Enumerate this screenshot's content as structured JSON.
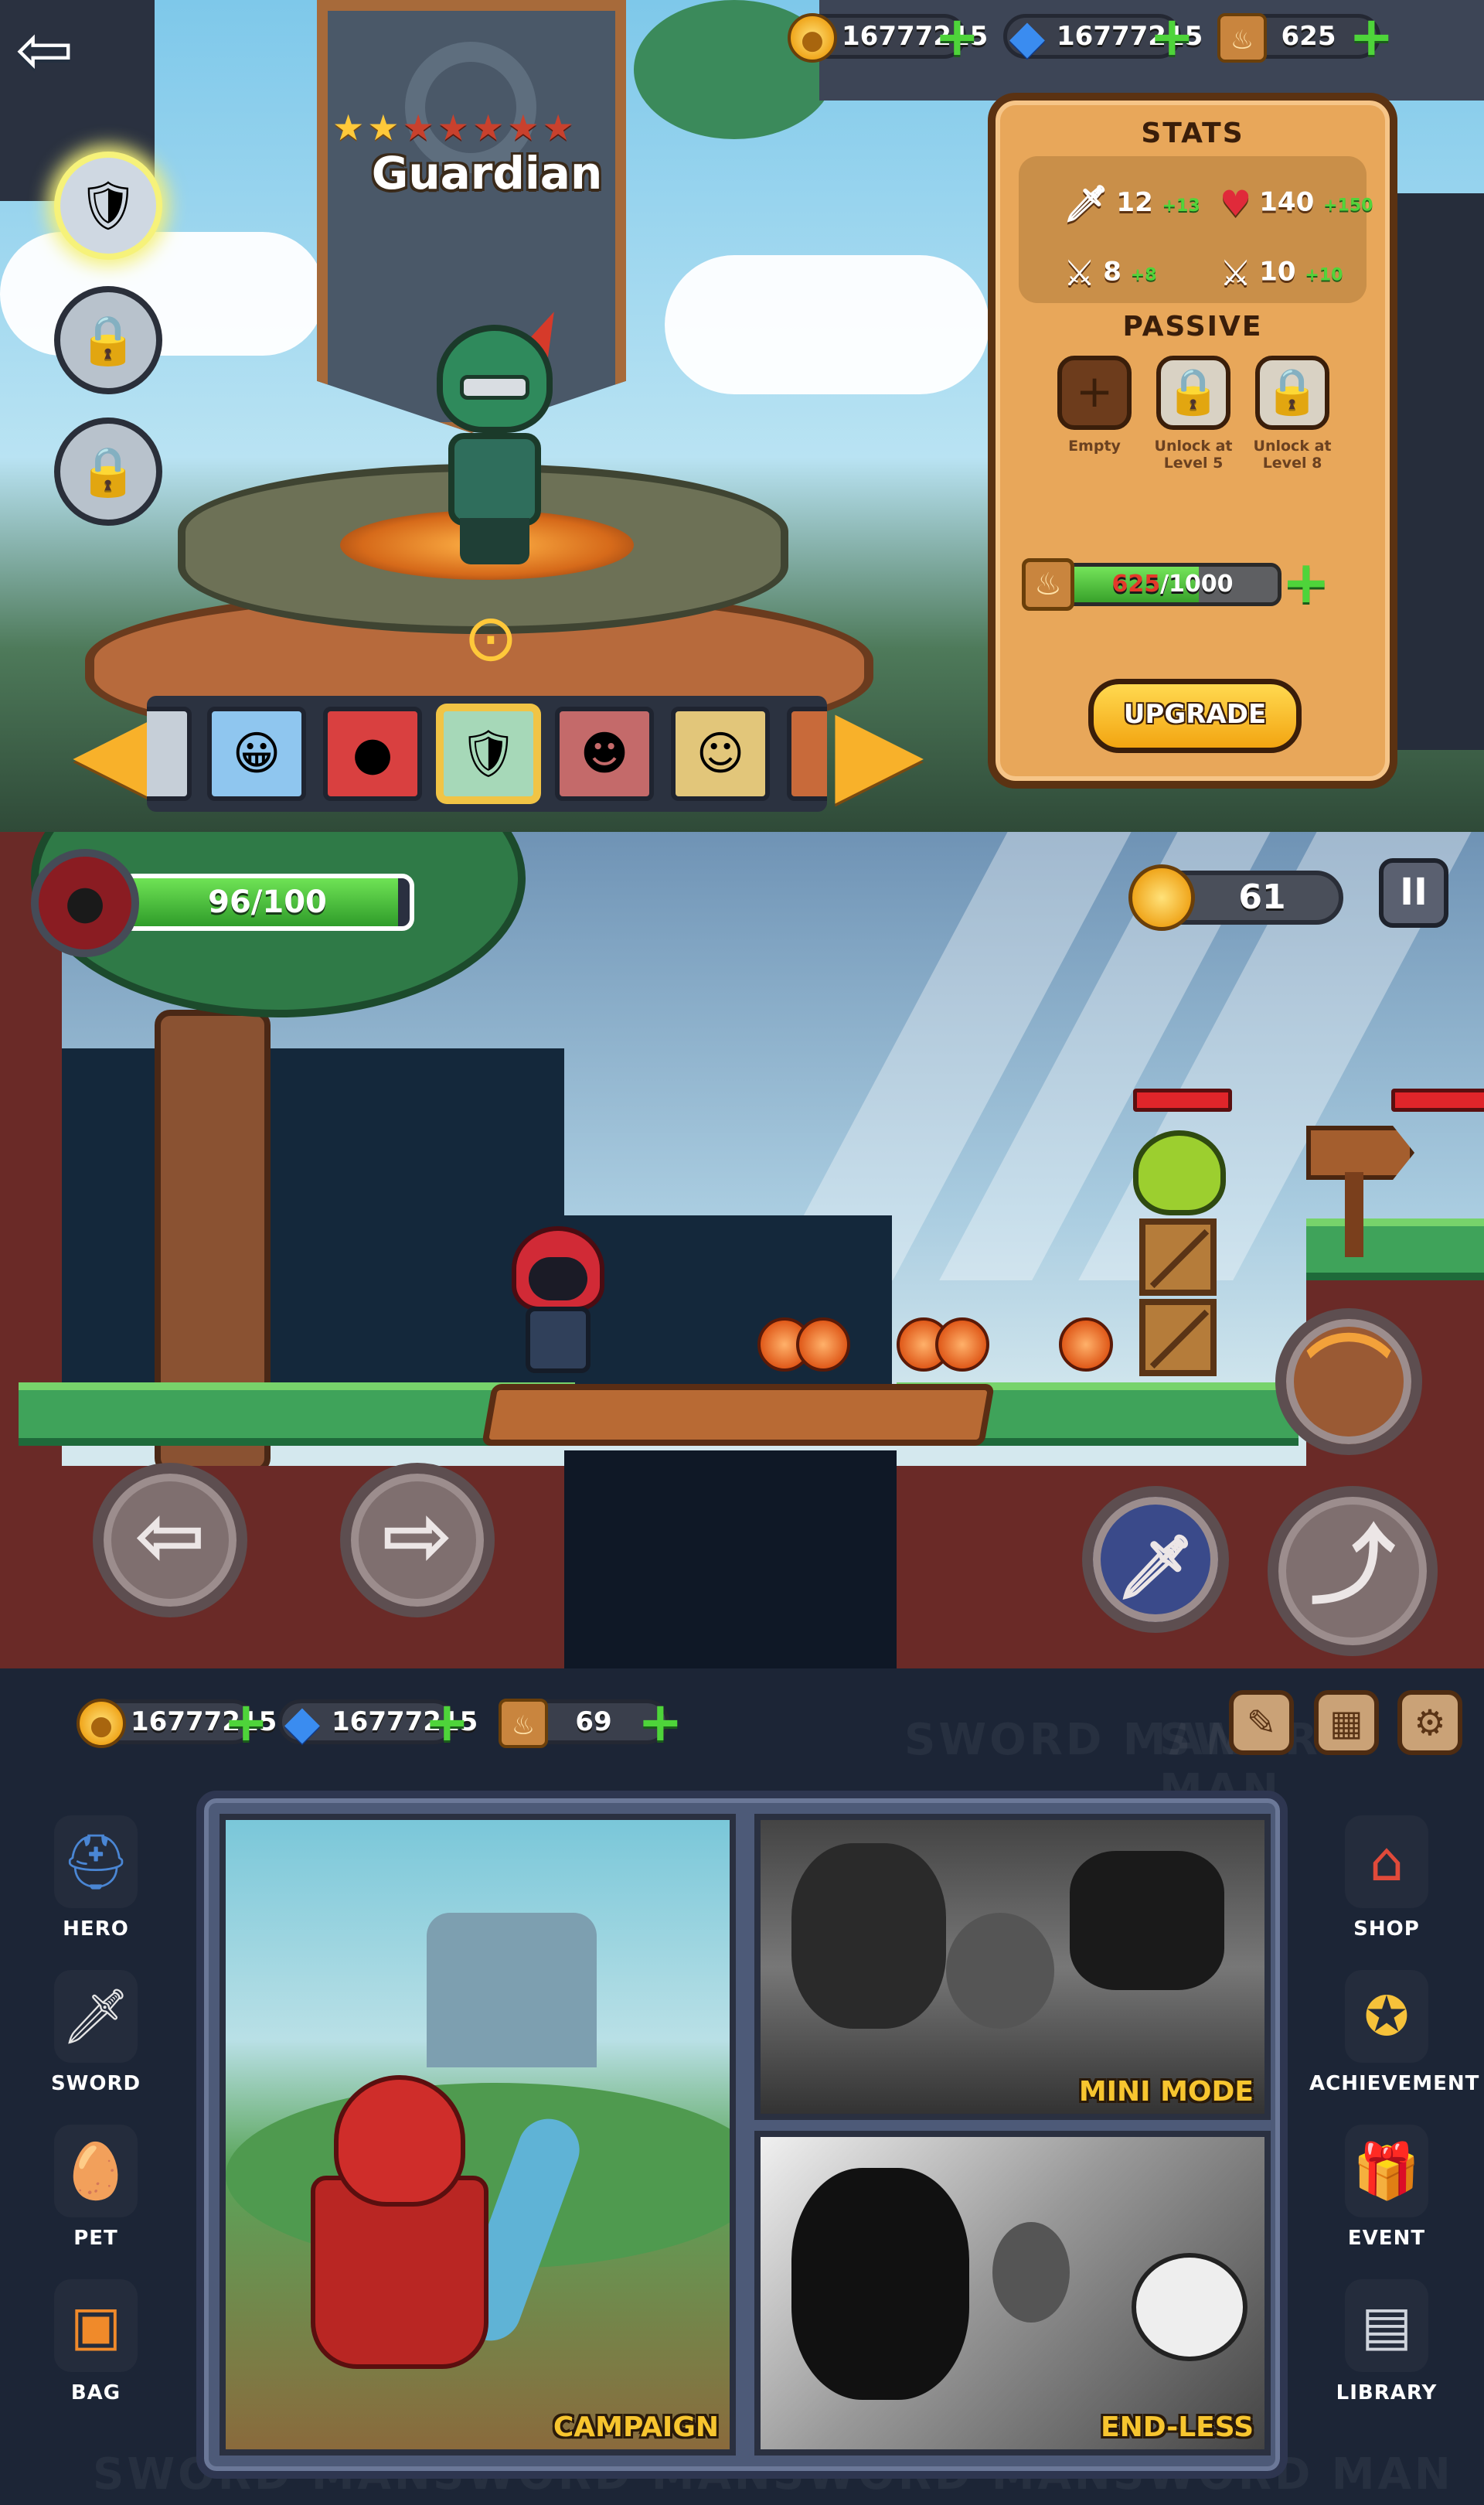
{
  "hero_select": {
    "back_icon": "back-arrow-icon",
    "resources": {
      "coins": "16777215",
      "gems": "16777215",
      "energy": "625"
    },
    "hero_name": "Guardian",
    "stars_filled": 2,
    "stars_total": 7,
    "side_heroes": [
      "guardian-icon",
      "locked-hero-icon",
      "locked-hero-icon"
    ],
    "roster": [
      "hero-blue-hair",
      "hero-red-hood",
      "hero-guardian",
      "hero-ninja",
      "hero-knight"
    ],
    "stats": {
      "title": "STATS",
      "attack": {
        "value": "12",
        "bonus": "+13"
      },
      "health": {
        "value": "140",
        "bonus": "+150"
      },
      "stat3": {
        "value": "8",
        "bonus": "+8"
      },
      "stat4": {
        "value": "10",
        "bonus": "+10"
      },
      "passive_title": "PASSIVE",
      "passive_slots": [
        {
          "label": "Empty"
        },
        {
          "label": "Unlock at Level 5"
        },
        {
          "label": "Unlock at Level 8"
        }
      ],
      "xp_current": "625",
      "xp_max": "/1000",
      "xp_fraction": 0.625,
      "upgrade_label": "UPGRADE"
    }
  },
  "gameplay": {
    "hp_text": "96/100",
    "hp_fraction": 0.96,
    "coins": "61",
    "controls": {
      "left": "move-left-icon",
      "right": "move-right-icon",
      "sword": "sword-attack-icon",
      "jump": "jump-icon",
      "throw": "boomerang-icon"
    }
  },
  "main_menu": {
    "resources": {
      "coins": "16777215",
      "gems": "16777215",
      "energy": "69"
    },
    "left_menu": [
      {
        "label": "HERO",
        "icon": "helmet-icon"
      },
      {
        "label": "SWORD",
        "icon": "sword-icon"
      },
      {
        "label": "PET",
        "icon": "egg-icon"
      },
      {
        "label": "BAG",
        "icon": "chest-icon"
      }
    ],
    "right_menu": [
      {
        "label": "SHOP",
        "icon": "shop-icon"
      },
      {
        "label": "ACHIEVEMENT",
        "icon": "medal-icon"
      },
      {
        "label": "EVENT",
        "icon": "gift-icon"
      },
      {
        "label": "LIBRARY",
        "icon": "book-icon"
      }
    ],
    "modes": {
      "campaign": "CAMPAIGN",
      "mini": "MINI MODE",
      "endless": "END-LESS"
    },
    "watermark": "SWORD MAN"
  }
}
